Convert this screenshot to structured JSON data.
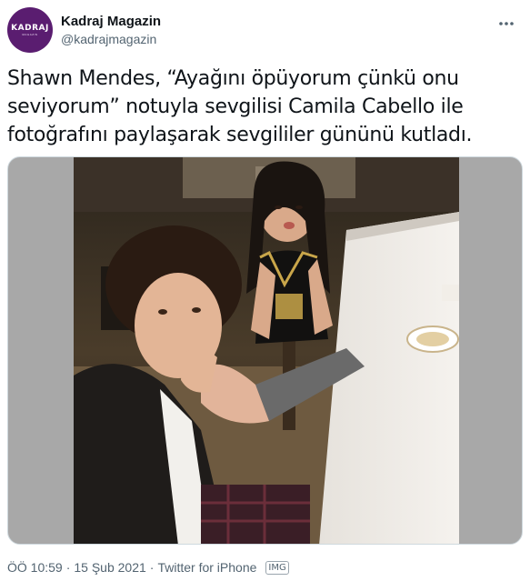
{
  "account": {
    "display_name": "Kadraj Magazin",
    "handle": "@kadrajmagazin",
    "avatar_logo": "KADRAJ",
    "avatar_sub": "MAGAZIN",
    "avatar_color": "#5a1d70"
  },
  "tweet": {
    "text_line_1": "Shawn Mendes, “Ayağını öpüyorum çünkü onu",
    "text_line_2": "seviyorum” notuyla sevgilisi Camila Cabello ile",
    "text_line_3": "fotoğrafını paylaşarak sevgililer gününü kutladı.",
    "media_icon": "photo-image"
  },
  "meta": {
    "time": "ÖÖ 10:59",
    "date": "15 Şub 2021",
    "separator": "·",
    "source": "Twitter for iPhone",
    "badge": "IMG"
  },
  "icons": {
    "more": "more-horizontal-icon"
  },
  "colors": {
    "text_primary": "#0f1419",
    "text_secondary": "#536471",
    "media_background": "#a8a8a8"
  }
}
